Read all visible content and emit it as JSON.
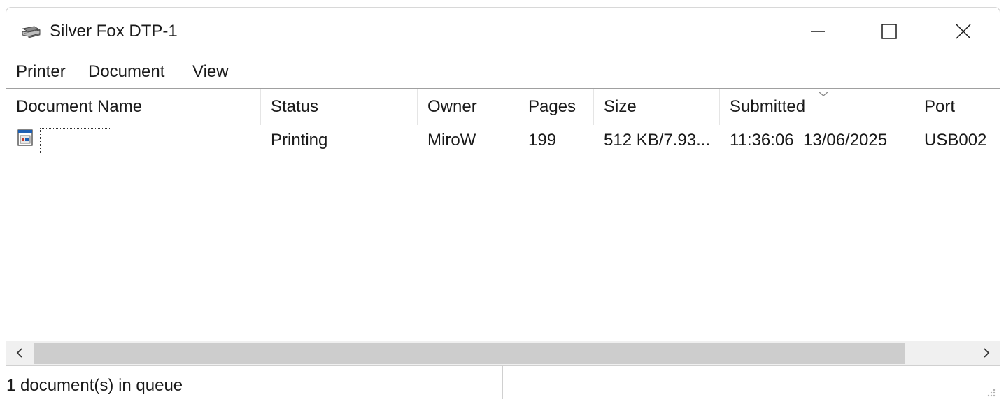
{
  "window": {
    "title": "Silver Fox DTP-1",
    "icon": "printer-icon",
    "controls": [
      "minimize-icon",
      "maximize-icon",
      "close-icon"
    ]
  },
  "menu": {
    "items": [
      "Printer",
      "Document",
      "View"
    ]
  },
  "table": {
    "columns": [
      "Document Name",
      "Status",
      "Owner",
      "Pages",
      "Size",
      "Submitted",
      "Port"
    ],
    "sorted_column": "Submitted",
    "rows": [
      {
        "document_name": "",
        "status": "Printing",
        "owner": "MiroW",
        "pages": "199",
        "size": "512 KB/7.93...",
        "submitted": "11:36:06  13/06/2025",
        "port": "USB002"
      }
    ]
  },
  "scrollbar": {
    "left_icon": "chevron-left-icon",
    "right_icon": "chevron-right-icon"
  },
  "status": {
    "text": "1 document(s) in queue"
  }
}
